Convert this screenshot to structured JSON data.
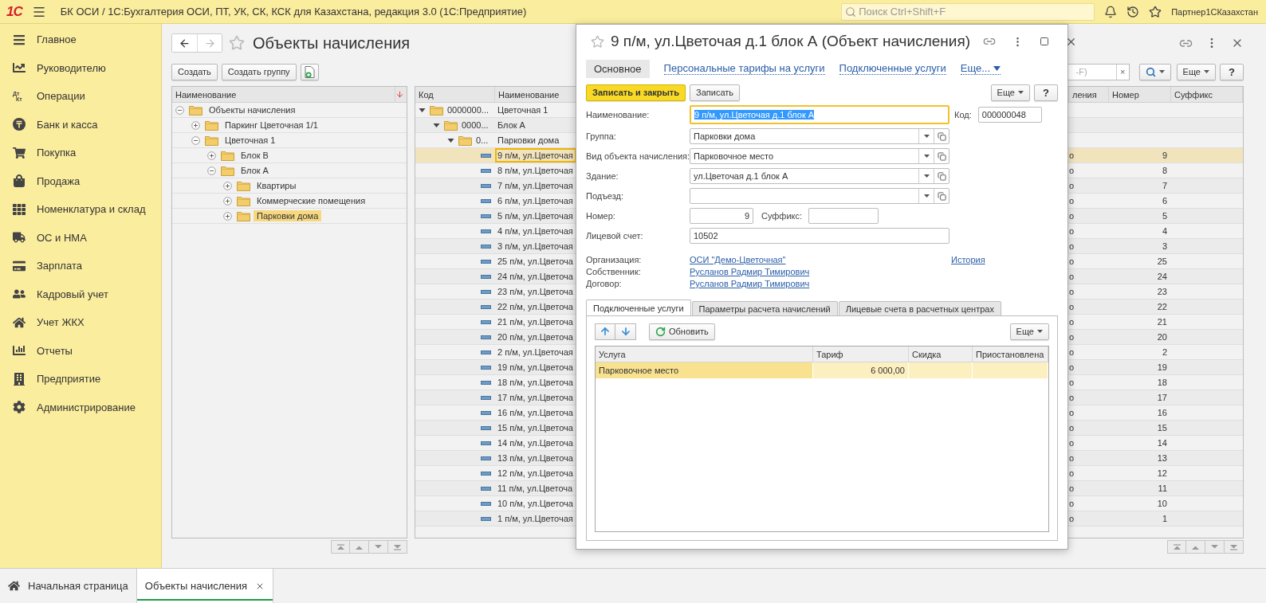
{
  "app": {
    "logo": "1С",
    "title": "БК ОСИ / 1С:Бухгалтерия ОСИ, ПТ, УК, СК, КСК для Казахстана, редакция 3.0  (1С:Предприятие)",
    "search_placeholder": "Поиск Ctrl+Shift+F",
    "user": "Партнер1СКазахстан"
  },
  "sidebar": {
    "items": [
      {
        "label": "Главное"
      },
      {
        "label": "Руководителю"
      },
      {
        "label": "Операции",
        "icon_text": [
          "Дт",
          "Кт"
        ]
      },
      {
        "label": "Банк и касса"
      },
      {
        "label": "Покупка"
      },
      {
        "label": "Продажа"
      },
      {
        "label": "Номенклатура и склад"
      },
      {
        "label": "ОС и НМА"
      },
      {
        "label": "Зарплата"
      },
      {
        "label": "Кадровый учет"
      },
      {
        "label": "Учет ЖКХ"
      },
      {
        "label": "Отчеты"
      },
      {
        "label": "Предприятие"
      },
      {
        "label": "Администрирование"
      }
    ]
  },
  "page": {
    "title": "Объекты начисления",
    "buttons": [
      "Создать",
      "Создать группу"
    ]
  },
  "tree": {
    "column": "Наименование",
    "items": [
      {
        "label": "Объекты начисления",
        "expanded": true,
        "selected": false,
        "children": [
          {
            "label": "Паркинг Цветочная 1/1",
            "expanded": false,
            "selected": false
          },
          {
            "label": "Цветочная 1",
            "expanded": true,
            "selected": false,
            "children": [
              {
                "label": "Блок В",
                "expanded": false,
                "selected": false
              },
              {
                "label": "Блок А",
                "expanded": true,
                "selected": false,
                "children": [
                  {
                    "label": "Квартиры",
                    "expanded": false,
                    "selected": false
                  },
                  {
                    "label": "Коммерческие помещения",
                    "expanded": false,
                    "selected": false
                  },
                  {
                    "label": "Парковки дома",
                    "expanded": false,
                    "selected": true
                  }
                ]
              }
            ]
          }
        ]
      }
    ]
  },
  "list": {
    "search_placeholder": "-F)",
    "search_clear": "×",
    "more": "Еще",
    "help": "?",
    "columns": [
      "Код",
      "Наименование",
      "ления",
      "Номер",
      "Суффикс"
    ],
    "rows": [
      {
        "kind": "group",
        "code": "0000000...",
        "name": "Цветочная 1",
        "expanded": true,
        "selected": false,
        "children": [
          {
            "kind": "group",
            "code": "0000...",
            "name": "Блок А",
            "expanded": true,
            "selected": false,
            "children": [
              {
                "kind": "group",
                "code": "0...",
                "name": "Парковки дома",
                "expanded": true,
                "selected": false,
                "children": [
                  {
                    "kind": "item",
                    "name": "9 п/м, ул.Цветочая",
                    "column_3": "о",
                    "number": "9",
                    "selected": true
                  },
                  {
                    "kind": "item",
                    "name": "8 п/м, ул.Цветочая",
                    "column_3": "о",
                    "number": "8",
                    "selected": false
                  },
                  {
                    "kind": "item",
                    "name": "7 п/м, ул.Цветочая",
                    "column_3": "о",
                    "number": "7",
                    "selected": false
                  },
                  {
                    "kind": "item",
                    "name": "6 п/м, ул.Цветочая",
                    "column_3": "о",
                    "number": "6",
                    "selected": false
                  },
                  {
                    "kind": "item",
                    "name": "5 п/м, ул.Цветочая",
                    "column_3": "о",
                    "number": "5",
                    "selected": false
                  },
                  {
                    "kind": "item",
                    "name": "4 п/м, ул.Цветочая",
                    "column_3": "о",
                    "number": "4",
                    "selected": false
                  },
                  {
                    "kind": "item",
                    "name": "3 п/м, ул.Цветочая",
                    "column_3": "о",
                    "number": "3",
                    "selected": false
                  },
                  {
                    "kind": "item",
                    "name": "25 п/м, ул.Цветоча",
                    "column_3": "о",
                    "number": "25",
                    "selected": false
                  },
                  {
                    "kind": "item",
                    "name": "24 п/м, ул.Цветоча",
                    "column_3": "о",
                    "number": "24",
                    "selected": false
                  },
                  {
                    "kind": "item",
                    "name": "23 п/м, ул.Цветоча",
                    "column_3": "о",
                    "number": "23",
                    "selected": false
                  },
                  {
                    "kind": "item",
                    "name": "22 п/м, ул.Цветоча",
                    "column_3": "о",
                    "number": "22",
                    "selected": false
                  },
                  {
                    "kind": "item",
                    "name": "21 п/м, ул.Цветоча",
                    "column_3": "о",
                    "number": "21",
                    "selected": false
                  },
                  {
                    "kind": "item",
                    "name": "20 п/м, ул.Цветоча",
                    "column_3": "о",
                    "number": "20",
                    "selected": false
                  },
                  {
                    "kind": "item",
                    "name": "2 п/м, ул.Цветочая",
                    "column_3": "о",
                    "number": "2",
                    "selected": false
                  },
                  {
                    "kind": "item",
                    "name": "19 п/м, ул.Цветоча",
                    "column_3": "о",
                    "number": "19",
                    "selected": false
                  },
                  {
                    "kind": "item",
                    "name": "18 п/м, ул.Цветоча",
                    "column_3": "о",
                    "number": "18",
                    "selected": false
                  },
                  {
                    "kind": "item",
                    "name": "17 п/м, ул.Цветоча",
                    "column_3": "о",
                    "number": "17",
                    "selected": false
                  },
                  {
                    "kind": "item",
                    "name": "16 п/м, ул.Цветоча",
                    "column_3": "о",
                    "number": "16",
                    "selected": false
                  },
                  {
                    "kind": "item",
                    "name": "15 п/м, ул.Цветоча",
                    "column_3": "о",
                    "number": "15",
                    "selected": false
                  },
                  {
                    "kind": "item",
                    "name": "14 п/м, ул.Цветоча",
                    "column_3": "о",
                    "number": "14",
                    "selected": false
                  },
                  {
                    "kind": "item",
                    "name": "13 п/м, ул.Цветоча",
                    "column_3": "о",
                    "number": "13",
                    "selected": false
                  },
                  {
                    "kind": "item",
                    "name": "12 п/м, ул.Цветоча",
                    "column_3": "о",
                    "number": "12",
                    "selected": false
                  },
                  {
                    "kind": "item",
                    "name": "11 п/м, ул.Цветоча",
                    "column_3": "о",
                    "number": "11",
                    "selected": false
                  },
                  {
                    "kind": "item",
                    "name": "10 п/м, ул.Цветоча",
                    "column_3": "о",
                    "number": "10",
                    "selected": false
                  },
                  {
                    "kind": "item",
                    "name": "1 п/м, ул.Цветочая",
                    "column_3": "о",
                    "number": "1",
                    "selected": false
                  }
                ]
              }
            ]
          }
        ]
      }
    ]
  },
  "dialog": {
    "title": "9 п/м, ул.Цветочая д.1 блок А (Объект начисления)",
    "tabs": [
      {
        "label": "Основное",
        "selected": true
      },
      {
        "label": "Персональные тарифы на услуги",
        "selected": false
      },
      {
        "label": "Подключенные услуги",
        "selected": false
      }
    ],
    "tabs_more": "Еще...",
    "buttons": {
      "save_close": "Записать и закрыть",
      "save": "Записать",
      "more": "Еще",
      "help": "?"
    },
    "name": {
      "label": "Наименование:",
      "value": "9 п/м, ул.Цветочая д.1 блок А",
      "focused": true,
      "code_label": "Код:",
      "code": "000000048"
    },
    "selects": [
      {
        "label": "Группа:",
        "value": "Парковки дома"
      },
      {
        "label": "Вид объекта начисления:",
        "value": "Парковочное место"
      },
      {
        "label": "Здание:",
        "value": "ул.Цветочая д.1 блок А"
      },
      {
        "label": "Подъезд:"
      }
    ],
    "number": {
      "label": "Номер:",
      "value": "9",
      "suffix_label": "Суффикс:"
    },
    "account": {
      "label": "Лицевой счет:",
      "value": "10502"
    },
    "links": [
      {
        "label": "Организация:",
        "value": "ОСИ \"Демо-Цветочная\""
      },
      {
        "label": "Собственник:",
        "value": "Русланов Радмир Тимирович"
      },
      {
        "label": "Договор:",
        "value": "Русланов Радмир Тимирович"
      }
    ],
    "history": "История",
    "inner_tabs": [
      {
        "label": "Подключенные услуги",
        "selected": true
      },
      {
        "label": "Параметры расчета начислений",
        "selected": false
      },
      {
        "label": "Лицевые счета в расчетных центрах",
        "selected": false
      }
    ],
    "refresh": "Обновить",
    "inner_more": "Еще",
    "services": {
      "columns": [
        "Услуга",
        "Тариф",
        "Скидка",
        "Приостановлена"
      ],
      "rows": [
        {
          "service": "Парковочное место",
          "tariff": "6 000,00",
          "selected": true
        }
      ]
    }
  },
  "bottom_tabs": [
    {
      "label": "Начальная страница",
      "selected": false
    },
    {
      "label": "Объекты начисления",
      "selected": true
    }
  ]
}
